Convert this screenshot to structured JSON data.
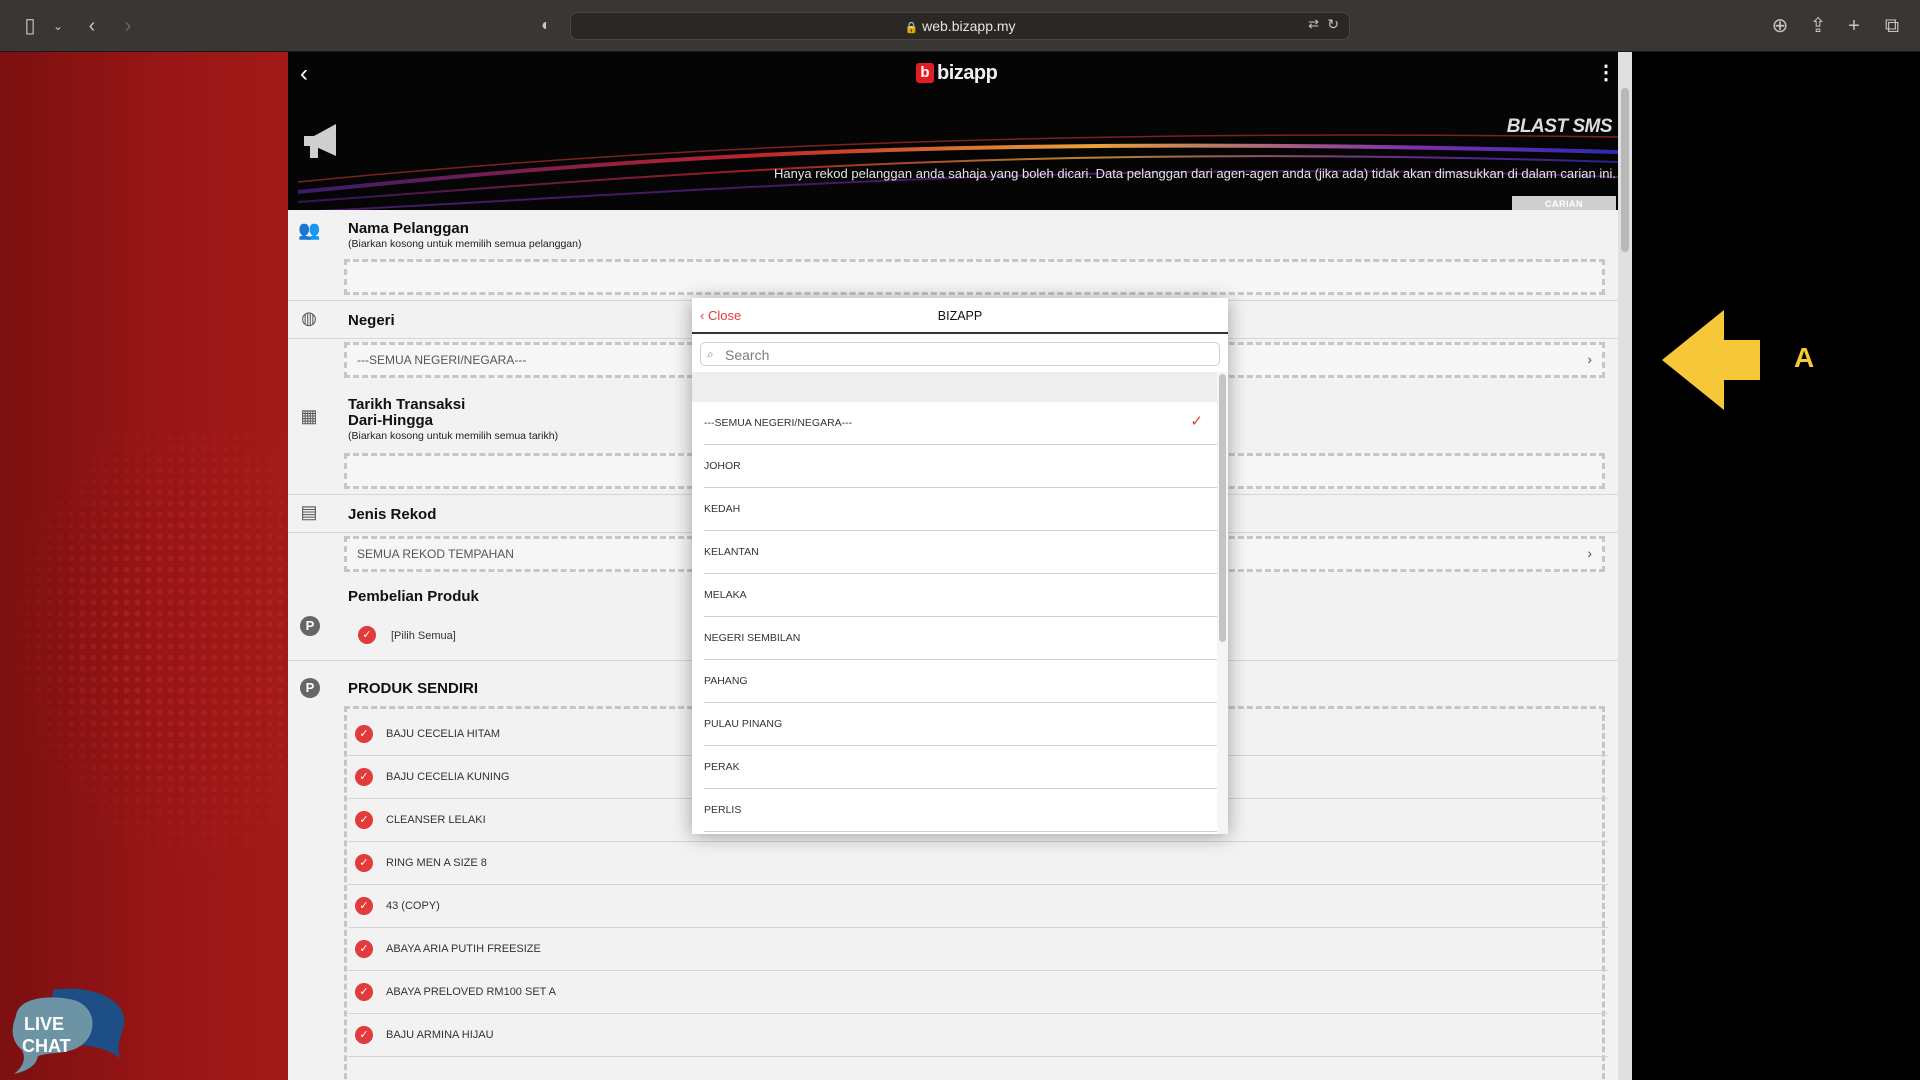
{
  "browser": {
    "url": "web.bizapp.my"
  },
  "header": {
    "logo_text": "bizapp",
    "logo_letter": "b",
    "page_title": "BLAST SMS",
    "note": "Hanya rekod pelanggan anda sahaja yang boleh dicari. Data pelanggan dari agen-agen anda (jika ada) tidak akan dimasukkan di dalam carian ini.",
    "search_tab": "CARIAN"
  },
  "form": {
    "customer_label": "Nama Pelanggan",
    "customer_hint": "(Biarkan kosong untuk memilih semua pelanggan)",
    "state_label": "Negeri",
    "state_value": "---SEMUA NEGERI/NEGARA---",
    "date_label_1": "Tarikh Transaksi",
    "date_label_2": "Dari-Hingga",
    "date_hint": "(Biarkan kosong untuk memilih semua tarikh)",
    "record_type_label": "Jenis Rekod",
    "record_type_value": "SEMUA REKOD TEMPAHAN",
    "purchase_label": "Pembelian Produk",
    "select_all": "[Pilih Semua]",
    "own_products_label": "PRODUK SENDIRI",
    "products": [
      "BAJU CECELIA HITAM",
      "BAJU CECELIA KUNING",
      "CLEANSER LELAKI",
      "RING MEN A SIZE 8",
      "43 (COPY)",
      "ABAYA ARIA PUTIH FREESIZE",
      "ABAYA PRELOVED RM100 SET A",
      "BAJU ARMINA HIJAU"
    ]
  },
  "modal": {
    "close_label": "Close",
    "title": "BIZAPP",
    "search_placeholder": "Search",
    "options": [
      "---SEMUA NEGERI/NEGARA---",
      "JOHOR",
      "KEDAH",
      "KELANTAN",
      "MELAKA",
      "NEGERI SEMBILAN",
      "PAHANG",
      "PULAU PINANG",
      "PERAK",
      "PERLIS"
    ],
    "selected_option": "---SEMUA NEGERI/NEGARA---"
  },
  "annotation": {
    "label": "A",
    "color": "#f6c839"
  },
  "livechat": {
    "line1": "LIVE",
    "line2": "CHAT"
  },
  "colors": {
    "accent": "#e23b3b",
    "banner": "#050505"
  }
}
